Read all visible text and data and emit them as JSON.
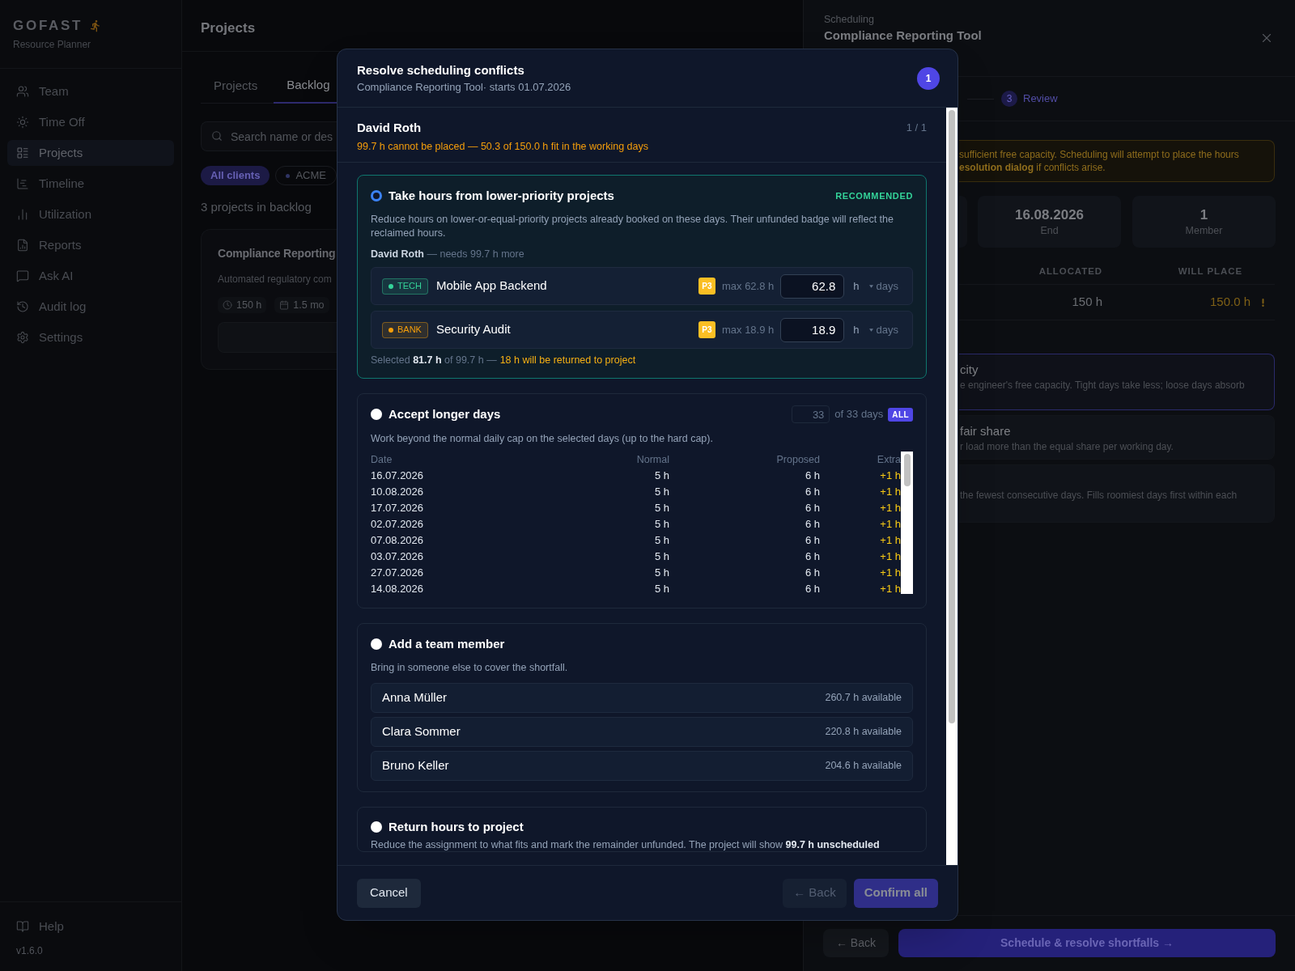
{
  "sidebar": {
    "logo": {
      "text": "GOFAST",
      "subtitle": "Resource Planner"
    },
    "nav_items": [
      {
        "label": "Team",
        "selected": false
      },
      {
        "label": "Time Off",
        "selected": false
      },
      {
        "label": "Projects",
        "selected": true
      },
      {
        "label": "Timeline",
        "selected": false
      },
      {
        "label": "Utilization",
        "selected": false
      },
      {
        "label": "Reports",
        "selected": false
      },
      {
        "label": "Ask AI",
        "selected": false
      },
      {
        "label": "Audit log",
        "selected": false
      },
      {
        "label": "Settings",
        "selected": false
      }
    ],
    "footer": {
      "help": "Help",
      "version": "v1.6.0"
    }
  },
  "main": {
    "title": "Projects",
    "tabs": [
      {
        "label": "Projects",
        "selected": false
      },
      {
        "label": "Backlog",
        "selected": true
      }
    ],
    "search": {
      "placeholder": "Search name or des"
    },
    "client_filters": [
      {
        "label": "All clients",
        "selected": true
      },
      {
        "label": "ACME",
        "selected": false,
        "color": "#2f3463"
      }
    ],
    "count_text": "3 projects in backlog",
    "project_card": {
      "title": "Compliance Reporting",
      "description": "Automated regulatory com",
      "chips": [
        {
          "kind": "hours",
          "label": "150 h"
        },
        {
          "kind": "duration",
          "label": "1.5 mo"
        }
      ]
    }
  },
  "scheduling_panel": {
    "eyebrow": "Scheduling",
    "title": "Compliance Reporting Tool",
    "steps": [
      {
        "number": "3",
        "label": "Review"
      }
    ],
    "notice_lines": [
      "sufficient free capacity. Scheduling will attempt to place the hours",
      "**esolution dialog** if conflicts arise."
    ],
    "stats": [
      {
        "value": "16.08.2026",
        "label": "End"
      },
      {
        "value": "1",
        "label": "Member"
      }
    ],
    "table": {
      "columns": [
        "ALLOCATED",
        "WILL PLACE"
      ],
      "rows": [
        {
          "cells": [
            "150 h",
            "150.0 h"
          ],
          "warning": true
        }
      ]
    },
    "strategies": [
      {
        "title": "city",
        "description": "e engineer's free capacity. Tight days take less; loose days absorb",
        "selected": true
      },
      {
        "title": "fair share",
        "description": "r load more than the equal share per working day.",
        "selected": false
      },
      {
        "description": "the fewest consecutive days. Fills roomiest days first within each",
        "selected": false
      }
    ],
    "buttons": [
      {
        "label": "← Back",
        "kind": "secondary"
      },
      {
        "label": "Schedule & resolve shortfalls →",
        "kind": "primary"
      }
    ]
  },
  "dialog": {
    "title": "Resolve scheduling conflicts",
    "subtitle": "Compliance Reporting Tool· starts 01.07.2026",
    "badge": "1",
    "member": {
      "name": "David Roth",
      "position": "1 / 1",
      "shortfall": "99.7 h cannot be placed — 50.3 of 150.0 h fit in the working days"
    },
    "options": [
      {
        "kind": "reclaim",
        "title": "Take hours from lower-priority projects",
        "selected": true,
        "badge": "RECOMMENDED",
        "description": "Reduce hours on lower-or-equal-priority projects already booked on these days. Their unfunded badge will reflect the reclaimed hours.",
        "need": "**David Roth** — needs 99.7 h more",
        "projects": [
          {
            "tag": {
              "label": "TECH",
              "color": "#34d399"
            },
            "name": "Mobile App Backend",
            "priority": "P3",
            "max": "max 62.8 h",
            "value": "62.8",
            "unit": "h",
            "mode": "days"
          },
          {
            "tag": {
              "label": "BANK",
              "color": "#f59e0b"
            },
            "name": "Security Audit",
            "priority": "P3",
            "max": "max 18.9 h",
            "value": "18.9",
            "unit": "h",
            "mode": "days"
          }
        ],
        "summary": "Selected **81.7 h** of 99.7 h —",
        "return_note": "18 h will be returned to project"
      },
      {
        "kind": "overtime",
        "title": "Accept longer days",
        "selected": false,
        "days_value": "33",
        "days_total": "of 33 days",
        "all_label": "ALL",
        "description": "Work beyond the normal daily cap on the selected days (up to the hard cap).",
        "table": {
          "columns": [
            "Date",
            "Normal",
            "Proposed",
            "Extra"
          ],
          "rows": [
            {
              "date": "16.07.2026",
              "normal": "5 h",
              "proposed": "6 h",
              "extra": "+1 h"
            },
            {
              "date": "10.08.2026",
              "normal": "5 h",
              "proposed": "6 h",
              "extra": "+1 h"
            },
            {
              "date": "17.07.2026",
              "normal": "5 h",
              "proposed": "6 h",
              "extra": "+1 h"
            },
            {
              "date": "02.07.2026",
              "normal": "5 h",
              "proposed": "6 h",
              "extra": "+1 h"
            },
            {
              "date": "07.08.2026",
              "normal": "5 h",
              "proposed": "6 h",
              "extra": "+1 h"
            },
            {
              "date": "03.07.2026",
              "normal": "5 h",
              "proposed": "6 h",
              "extra": "+1 h"
            },
            {
              "date": "27.07.2026",
              "normal": "5 h",
              "proposed": "6 h",
              "extra": "+1 h"
            },
            {
              "date": "14.08.2026",
              "normal": "5 h",
              "proposed": "6 h",
              "extra": "+1 h"
            }
          ]
        }
      },
      {
        "kind": "member",
        "title": "Add a team member",
        "selected": false,
        "description": "Bring in someone else to cover the shortfall.",
        "members": [
          {
            "name": "Anna Müller",
            "available": "260.7 h available"
          },
          {
            "name": "Clara Sommer",
            "available": "220.8 h available"
          },
          {
            "name": "Bruno Keller",
            "available": "204.6 h available"
          }
        ]
      },
      {
        "kind": "return",
        "title": "Return hours to project",
        "selected": false,
        "description": "Reduce the assignment to what fits and mark the remainder unfunded. The project will show **99.7 h unscheduled**"
      }
    ],
    "buttons": [
      {
        "label": "Cancel",
        "kind": "secondary",
        "disabled": false
      },
      {
        "label": "← Back",
        "kind": "ghost",
        "disabled": true
      },
      {
        "label": "Confirm all",
        "kind": "primary",
        "disabled": true
      }
    ]
  }
}
